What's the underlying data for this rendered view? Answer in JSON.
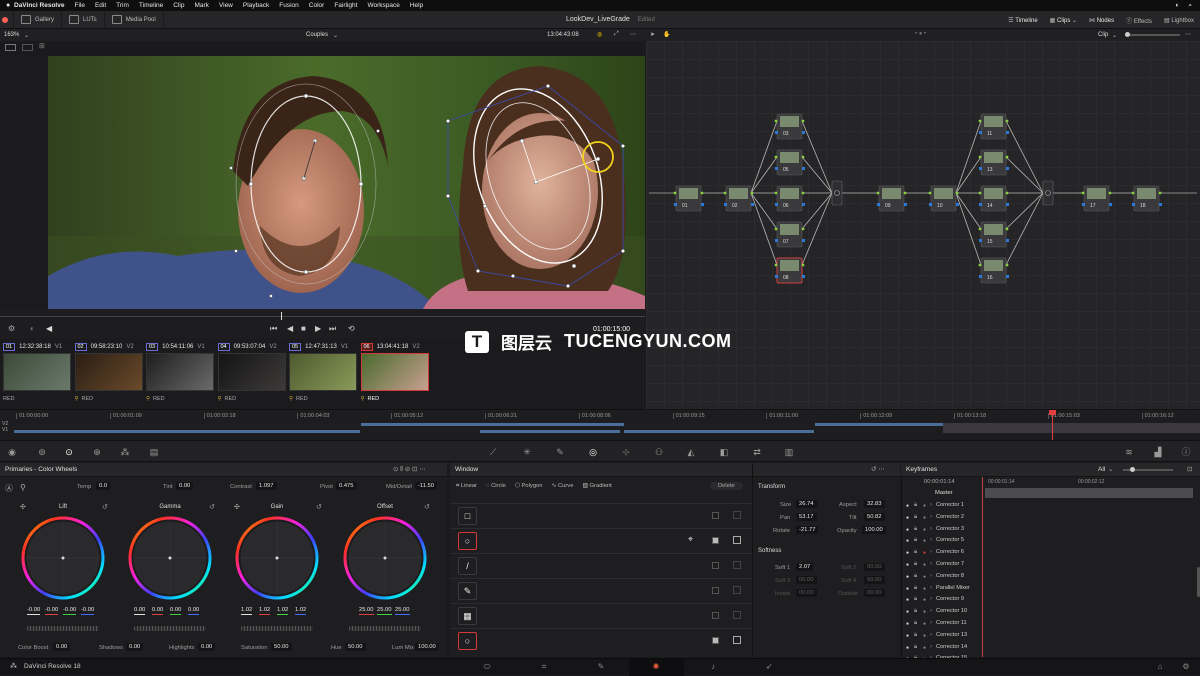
{
  "menubar": {
    "app": "DaVinci Resolve",
    "items": [
      "File",
      "Edit",
      "Trim",
      "Timeline",
      "Clip",
      "Mark",
      "View",
      "Playback",
      "Fusion",
      "Color",
      "Fairlight",
      "Workspace",
      "Help"
    ]
  },
  "toolbar": {
    "gallery": "Gallery",
    "luts": "LUTs",
    "media_pool": "Media Pool",
    "project": "LookDev_LiveGrade",
    "status": "Edited",
    "timeline": "Timeline",
    "clips": "Clips",
    "nodes": "Nodes",
    "effects": "Effects",
    "lightbox": "Lightbox"
  },
  "viewer": {
    "zoom": "163%",
    "clip_name": "Couples",
    "timecode": "13:04:43:08",
    "node_mode": "Clip",
    "current_tc": "01:00:15:00"
  },
  "clips": [
    {
      "num": "01",
      "tc": "12:32:38:18",
      "track": "V1",
      "codec": "RED"
    },
    {
      "num": "02",
      "tc": "09:58:23:10",
      "track": "V2",
      "codec": "RED"
    },
    {
      "num": "03",
      "tc": "10:54:11:06",
      "track": "V1",
      "codec": "RED"
    },
    {
      "num": "04",
      "tc": "09:53:07:04",
      "track": "V2",
      "codec": "RED"
    },
    {
      "num": "05",
      "tc": "12:47:31:13",
      "track": "V1",
      "codec": "RED"
    },
    {
      "num": "06",
      "tc": "13:04:41:18",
      "track": "V2",
      "codec": "RED"
    }
  ],
  "mini_timeline": {
    "ticks": [
      "01:00:00:00",
      "01:00:01:09",
      "01:00:02:18",
      "01:00:04:03",
      "01:00:05:12",
      "01:00:06:21",
      "01:00:08:06",
      "01:00:09:15",
      "01:00:11:00",
      "01:00:12:09",
      "01:00:13:18",
      "01:00:15:03",
      "01:00:16:12"
    ],
    "tracks": [
      "V2",
      "V1"
    ]
  },
  "nodes": {
    "labels": [
      "01",
      "02",
      "03",
      "05",
      "06",
      "07",
      "08",
      "09",
      "10",
      "11",
      "13",
      "14",
      "15",
      "16",
      "17",
      "18"
    ]
  },
  "primaries": {
    "title": "Primaries - Color Wheels",
    "temp_label": "Temp",
    "temp": "0.0",
    "tint_label": "Tint",
    "tint": "0.00",
    "contrast_label": "Contrast",
    "contrast": "1.097",
    "pivot_label": "Pivot",
    "pivot": "0.475",
    "middetail_label": "Mid/Detail",
    "middetail": "-11.50",
    "wheels": [
      {
        "name": "Lift",
        "values": [
          "-0.00",
          "-0.00",
          "-0.00",
          "-0.00"
        ]
      },
      {
        "name": "Gamma",
        "values": [
          "0.00",
          "0.00",
          "0.00",
          "0.00"
        ]
      },
      {
        "name": "Gain",
        "values": [
          "1.02",
          "1.02",
          "1.02",
          "1.02"
        ]
      },
      {
        "name": "Offset",
        "values": [
          "25.00",
          "25.00",
          "25.00"
        ]
      }
    ],
    "colorboost_label": "Color Boost",
    "colorboost": "0.00",
    "shadows_label": "Shadows",
    "shadows": "0.00",
    "highlights_label": "Highlights",
    "highlights": "0.00",
    "saturation_label": "Saturation",
    "saturation": "50.00",
    "hue_label": "Hue",
    "hue": "50.00",
    "lummix_label": "Lum Mix",
    "lummix": "100.00"
  },
  "window": {
    "title": "Window",
    "tools": [
      "Linear",
      "Circle",
      "Polygon",
      "Curve",
      "Gradient"
    ],
    "delete": "Delete"
  },
  "transform": {
    "title": "Transform",
    "size_label": "Size",
    "size": "26.74",
    "aspect_label": "Aspect",
    "aspect": "32.83",
    "pan_label": "Pan",
    "pan": "53.17",
    "tilt_label": "Tilt",
    "tilt": "50.82",
    "rotate_label": "Rotate",
    "rotate": "-21.77",
    "opacity_label": "Opacity",
    "opacity": "100.00",
    "softness_title": "Softness",
    "soft1_label": "Soft 1",
    "soft1": "2.07",
    "soft2_label": "Soft 2",
    "soft2": "00.00",
    "soft3_label": "Soft 3",
    "soft3": "00.00",
    "soft4_label": "Soft 4",
    "soft4": "50.00",
    "inside_label": "Inside",
    "inside": "00.00",
    "outside_label": "Outside",
    "outside": "00.00"
  },
  "keyframes": {
    "title": "Keyframes",
    "filter": "All",
    "tc_current": "00:00:01:14",
    "tc_a": "00:00:01:14",
    "tc_b": "00:00:02:12",
    "master": "Master",
    "rows": [
      "Corrector 1",
      "Corrector 2",
      "Corrector 3",
      "Corrector 5",
      "Corrector 6",
      "Corrector 7",
      "Corrector 8",
      "Parallel Mixer",
      "Corrector 9",
      "Corrector 10",
      "Corrector 11",
      "Corrector 13",
      "Corrector 14",
      "Corrector 15"
    ]
  },
  "bottom": {
    "app": "DaVinci Resolve 18"
  },
  "watermark": {
    "cn": "图层云",
    "en": "TUCENGYUN.COM"
  }
}
